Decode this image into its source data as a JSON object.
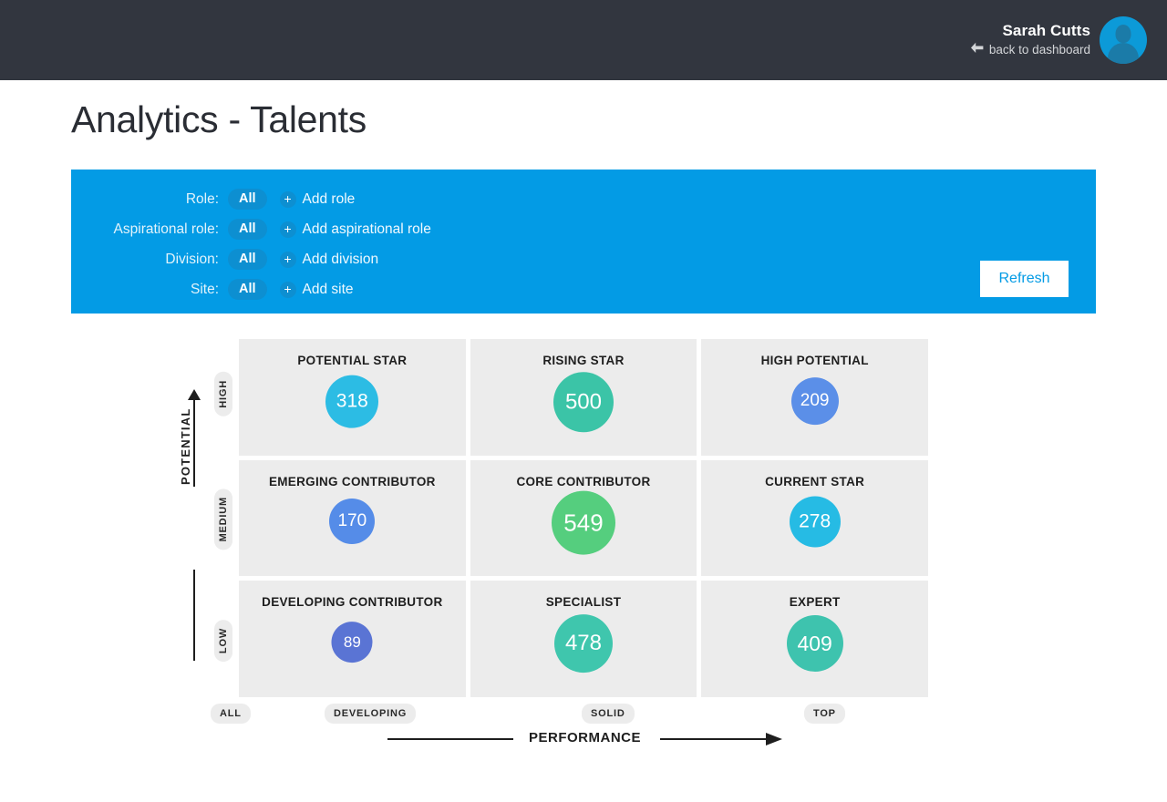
{
  "header": {
    "user_name": "Sarah Cutts",
    "back_label": "back to dashboard",
    "back_icon": "arrow-left-icon",
    "avatar_icon": "user-avatar-icon",
    "bg_color": "#32363f",
    "accent_color": "#0c9ad8"
  },
  "page": {
    "title": "Analytics - Talents"
  },
  "filters": {
    "bg_color": "#039be5",
    "rows": [
      {
        "label": "Role:",
        "value": "All",
        "add_label": "Add role",
        "add_icon": "plus-icon"
      },
      {
        "label": "Aspirational role:",
        "value": "All",
        "add_label": "Add aspirational role",
        "add_icon": "plus-icon"
      },
      {
        "label": "Division:",
        "value": "All",
        "add_label": "Add division",
        "add_icon": "plus-icon"
      },
      {
        "label": "Site:",
        "value": "All",
        "add_label": "Add site",
        "add_icon": "plus-icon"
      }
    ],
    "refresh_label": "Refresh"
  },
  "chart_data": {
    "type": "heatmap",
    "title": "Analytics - Talents",
    "xlabel": "PERFORMANCE",
    "ylabel": "POTENTIAL",
    "x_categories": [
      "DEVELOPING",
      "SOLID",
      "TOP"
    ],
    "y_categories": [
      "HIGH",
      "MEDIUM",
      "LOW"
    ],
    "x_origin_label": "ALL",
    "grid": false,
    "legend": "none",
    "cells": [
      {
        "row": "HIGH",
        "col": "DEVELOPING",
        "label": "POTENTIAL STAR",
        "value": 318,
        "color": "#2cbce4",
        "diameter": 58
      },
      {
        "row": "HIGH",
        "col": "SOLID",
        "label": "RISING STAR",
        "value": 500,
        "color": "#3bc4a7",
        "diameter": 66
      },
      {
        "row": "HIGH",
        "col": "TOP",
        "label": "HIGH POTENTIAL",
        "value": 209,
        "color": "#5b8fe8",
        "diameter": 52
      },
      {
        "row": "MEDIUM",
        "col": "DEVELOPING",
        "label": "EMERGING CONTRIBUTOR",
        "value": 170,
        "color": "#558ce8",
        "diameter": 50
      },
      {
        "row": "MEDIUM",
        "col": "SOLID",
        "label": "CORE CONTRIBUTOR",
        "value": 549,
        "color": "#55ce7e",
        "diameter": 70
      },
      {
        "row": "MEDIUM",
        "col": "TOP",
        "label": "CURRENT STAR",
        "value": 278,
        "color": "#26bbe4",
        "diameter": 56
      },
      {
        "row": "LOW",
        "col": "DEVELOPING",
        "label": "DEVELOPING CONTRIBUTOR",
        "value": 89,
        "color": "#5a74d4",
        "diameter": 45
      },
      {
        "row": "LOW",
        "col": "SOLID",
        "label": "SPECIALIST",
        "value": 478,
        "color": "#3fc6ad",
        "diameter": 64
      },
      {
        "row": "LOW",
        "col": "TOP",
        "label": "EXPERT",
        "value": 409,
        "color": "#3ec3ae",
        "diameter": 62
      }
    ]
  }
}
